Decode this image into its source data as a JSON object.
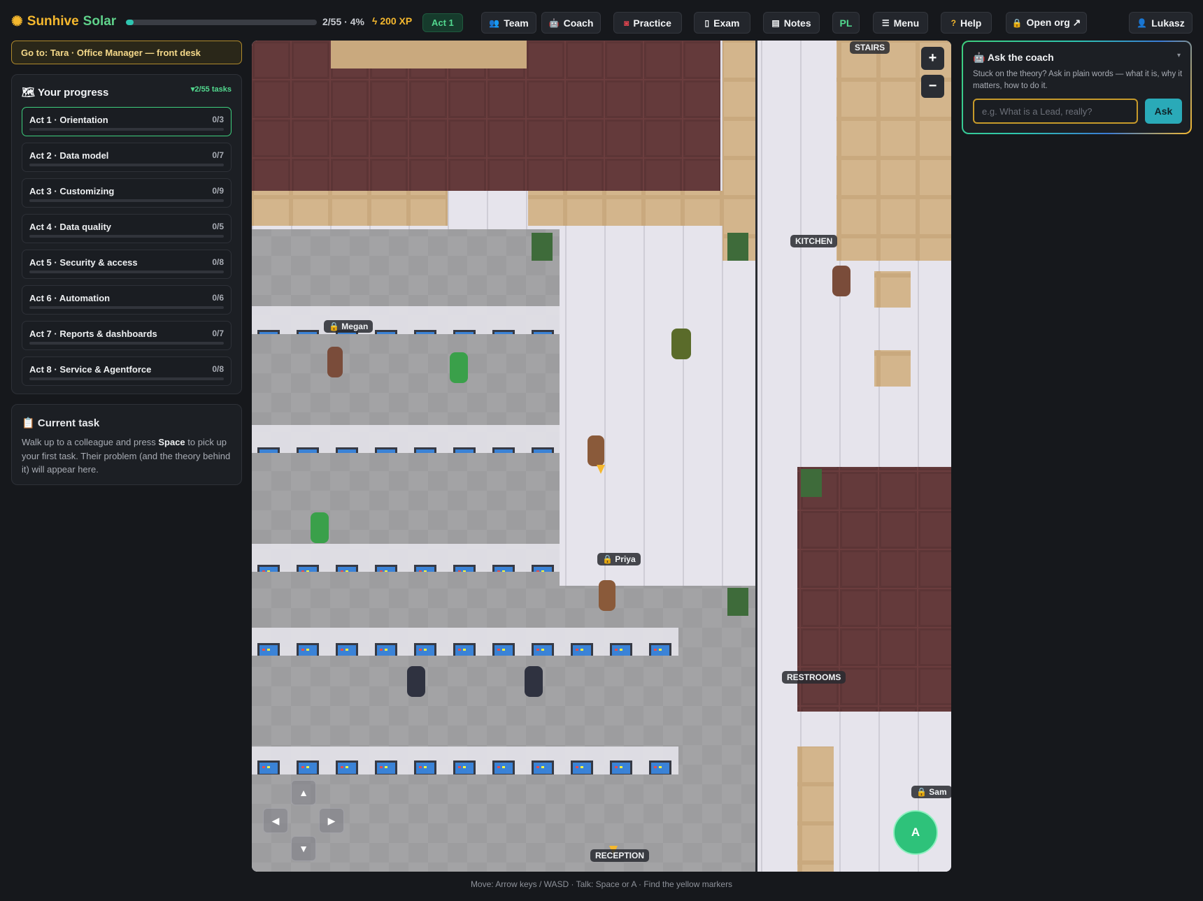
{
  "brand": {
    "icon": "sun-icon",
    "name1": "Sunhive",
    "name2": "Solar"
  },
  "progress_bar": {
    "fraction": 0.04,
    "text": "2/55 · 4%"
  },
  "xp": {
    "icon": "bolt-icon",
    "text": "200 XP"
  },
  "act_pill": "Act 1",
  "toolbar": [
    {
      "icon": "people-icon",
      "label": "Team"
    },
    {
      "icon": "robot-icon",
      "label": "Coach"
    },
    {
      "icon": "target-icon",
      "label": "Practice"
    },
    {
      "icon": "document-icon",
      "label": "Exam"
    },
    {
      "icon": "notepad-icon",
      "label": "Notes"
    },
    {
      "icon": "",
      "label": "PL"
    },
    {
      "icon": "hamburger-icon",
      "label": "Menu"
    },
    {
      "icon": "question-icon",
      "label": "Help"
    },
    {
      "icon": "lock-icon",
      "label": "Open org ↗"
    },
    {
      "icon": "person-icon",
      "label": "Lukasz"
    }
  ],
  "goto": "Go to: Tara · Office Manager — front desk",
  "progress": {
    "icon": "map-icon",
    "title": "Your progress",
    "summary": "2/55 tasks",
    "acts": [
      {
        "label": "Act 1 · Orientation",
        "count": "0/3",
        "done": 0
      },
      {
        "label": "Act 2 · Data model",
        "count": "0/7",
        "done": 0
      },
      {
        "label": "Act 3 · Customizing",
        "count": "0/9",
        "done": 0
      },
      {
        "label": "Act 4 · Data quality",
        "count": "0/5",
        "done": 0
      },
      {
        "label": "Act 5 · Security & access",
        "count": "0/8",
        "done": 0
      },
      {
        "label": "Act 6 · Automation",
        "count": "0/6",
        "done": 0
      },
      {
        "label": "Act 7 · Reports & dashboards",
        "count": "0/7",
        "done": 0
      },
      {
        "label": "Act 8 · Service & Agentforce",
        "count": "0/8",
        "done": 0
      }
    ]
  },
  "current_task": {
    "icon": "clipboard-icon",
    "title": "Current task",
    "text_before": "Walk up to a colleague and press ",
    "key": "Space",
    "text_after": " to pick up your first task. Their problem (and the theory behind it) will appear here."
  },
  "map": {
    "room_labels": [
      "STAIRS",
      "KITCHEN",
      "RESTROOMS",
      "RECEPTION"
    ],
    "npcs": [
      "Megan",
      "Priya",
      "Sam"
    ],
    "zoom_in": "+",
    "zoom_out": "−",
    "dpad": [
      "▲",
      "◀",
      "▶",
      "▼"
    ],
    "action_button": "A"
  },
  "hint": "Move: Arrow keys / WASD · Talk: Space or A · Find the yellow markers",
  "coach": {
    "icon": "robot-icon",
    "title": "Ask the coach",
    "chevron": "▾",
    "desc": "Stuck on the theory? Ask in plain words — what it is, why it matters, how to do it.",
    "placeholder": "e.g. What is a Lead, really?",
    "button": "Ask"
  },
  "colors": {
    "accent": "#2ec5b0",
    "gold": "#f5b82e",
    "green": "#52d98f"
  }
}
